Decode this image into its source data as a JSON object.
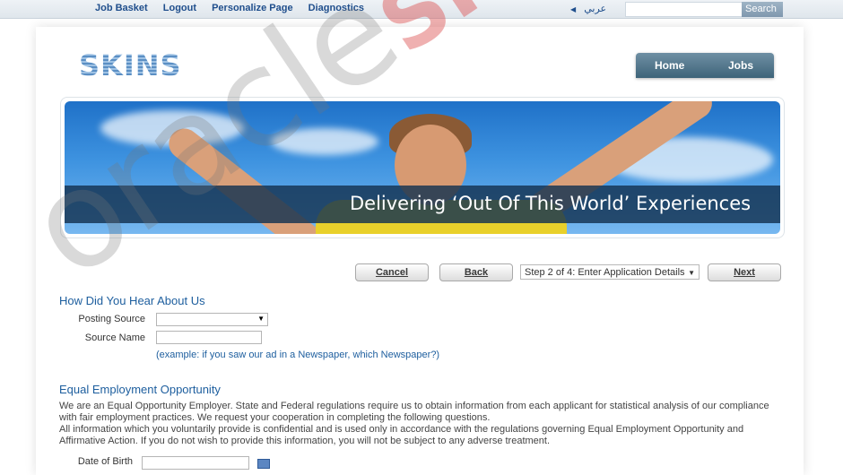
{
  "topbar": {
    "links": [
      "Job Basket",
      "Logout",
      "Personalize Page",
      "Diagnostics"
    ],
    "language": "عربي",
    "search_value": "",
    "search_button": "Search"
  },
  "header": {
    "logo_text": "SKINS",
    "nav": [
      "Home",
      "Jobs"
    ]
  },
  "banner": {
    "caption": "Delivering ‘Out Of This World’ Experiences"
  },
  "actions": {
    "cancel": "Cancel",
    "back": "Back",
    "step": "Step 2 of 4: Enter Application Details",
    "next": "Next"
  },
  "hear_about": {
    "title": "How Did You Hear About Us",
    "posting_source_label": "Posting Source",
    "posting_source_value": "",
    "source_name_label": "Source Name",
    "source_name_value": "",
    "hint": "(example: if you saw our ad in a Newspaper, which Newspaper?)"
  },
  "eeo": {
    "title": "Equal Employment Opportunity",
    "paragraph1": "We are an Equal Opportunity Employer. State and Federal regulations require us to obtain information from each applicant for statistical analysis of our compliance with fair employment practices. We request your cooperation in completing the following questions.",
    "paragraph2": "All information which you voluntarily provide is confidential and is used only in accordance with the regulations governing Equal Employment Opportunity and Affirmative Action. If you do not wish to provide this information, you will not be subject to any adverse treatment.",
    "dob_label": "Date of Birth",
    "dob_value": ""
  },
  "watermark": {
    "word1": "oracle",
    "word2": "SKINS"
  }
}
